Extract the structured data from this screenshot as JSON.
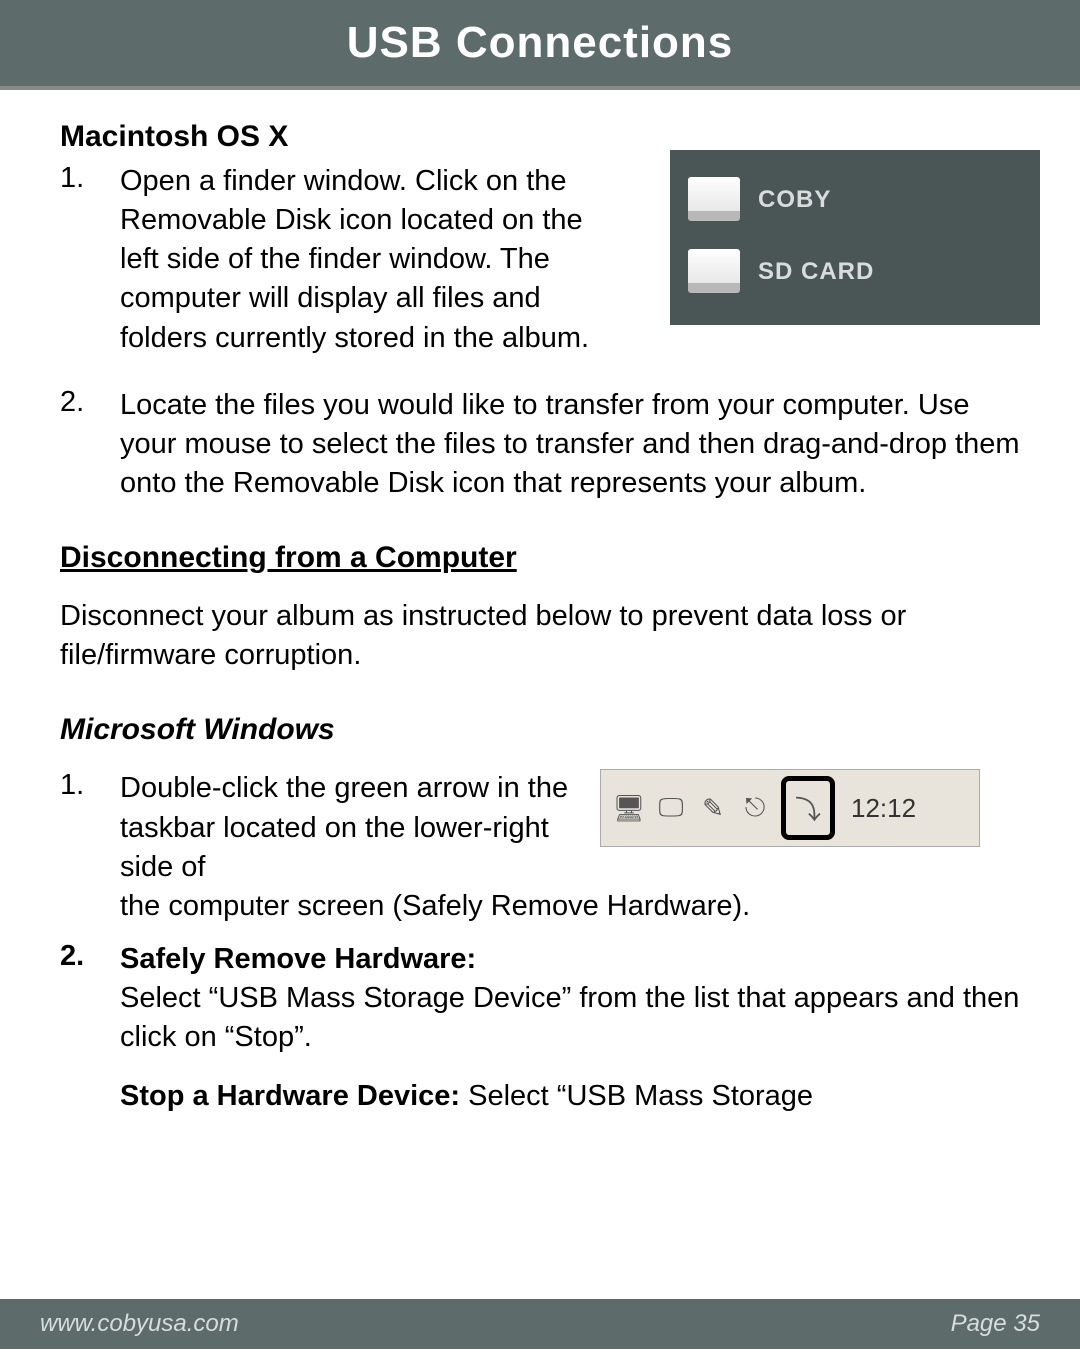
{
  "header": {
    "title": "USB Connections"
  },
  "mac": {
    "heading": "Macintosh OS X",
    "step1_num": "1.",
    "step1_text": "Open a finder window. Click on the Removable Disk icon located on the left side of the finder window. The computer will display all files and folders currently stored in the album.",
    "step2_num": "2.",
    "step2_text": "Locate the files you would like to transfer from your computer. Use your mouse to select the files to transfer and then drag-and-drop them onto the Removable Disk icon that represents your album.",
    "disk1": "COBY",
    "disk2": "SD CARD"
  },
  "disconnect": {
    "heading": "Disconnecting from a Computer",
    "intro": "Disconnect your album as instructed below to prevent data loss or file/firmware corruption."
  },
  "windows": {
    "heading": "Microsoft Windows",
    "step1_num": "1.",
    "step1_text_a": "Double-click the green arrow in the taskbar located on the lower-right side of",
    "step1_text_b": " the computer screen (Safely Remove Hardware).",
    "step2_num": "2.",
    "step2_label": "Safely Remove Hardware:",
    "step2_text": " Select “USB Mass Storage Device” from the list that appears and then click on “Stop”.",
    "step3_label": "Stop a Hardware Device:",
    "step3_text": " Select “USB Mass Storage",
    "clock": "12:12"
  },
  "footer": {
    "url": "www.cobyusa.com",
    "page": "Page 35"
  }
}
